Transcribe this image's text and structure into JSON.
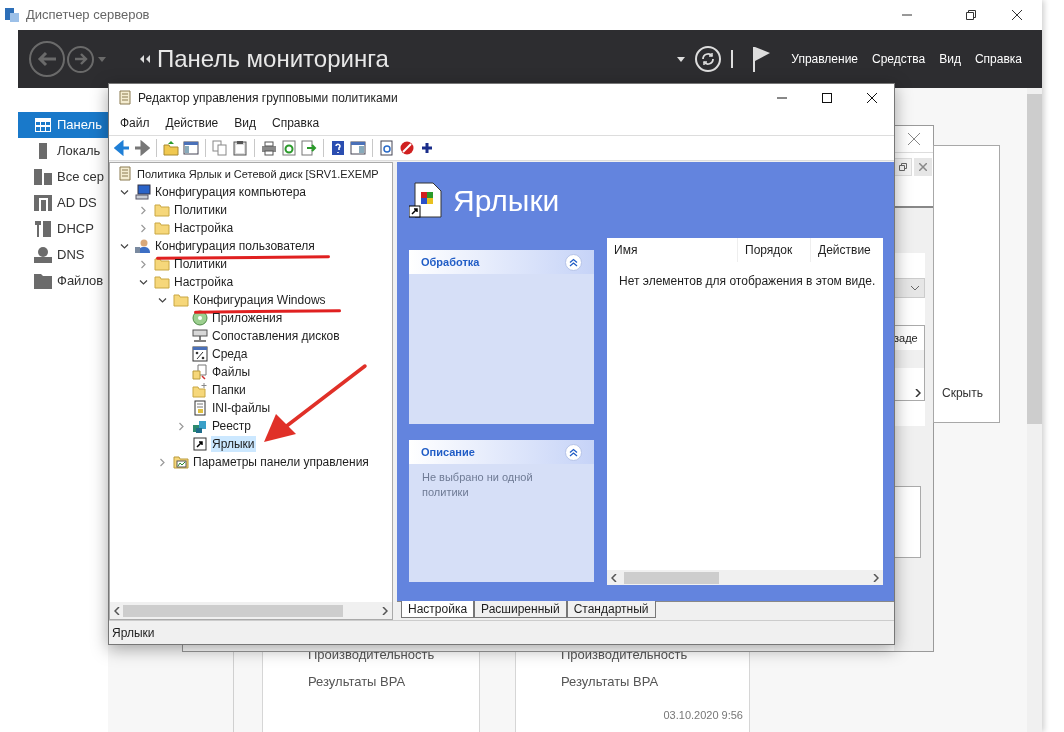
{
  "server_manager": {
    "title": "Диспетчер серверов",
    "header_title": "Панель мониторинга",
    "menu": [
      "Управление",
      "Средства",
      "Вид",
      "Справка"
    ],
    "sidebar": [
      {
        "kind": "dashboard",
        "label": "Панель",
        "selected": true
      },
      {
        "kind": "server",
        "label": "Локаль",
        "selected": false
      },
      {
        "kind": "servers",
        "label": "Все сер",
        "selected": false
      },
      {
        "kind": "adds",
        "label": "AD DS",
        "selected": false
      },
      {
        "kind": "dhcp",
        "label": "DHCP",
        "selected": false
      },
      {
        "kind": "dns",
        "label": "DNS",
        "selected": false
      },
      {
        "kind": "files",
        "label": "Файлов",
        "selected": false
      }
    ],
    "tiles": [
      {
        "items": [
          "Производительность",
          "Результаты BPA"
        ]
      },
      {
        "items": [
          "Производительность",
          "Результаты BPA"
        ],
        "timestamp": "03.10.2020 9:56"
      }
    ]
  },
  "background_dialog": {
    "column_text": "заде",
    "hide_button": "Скрыть"
  },
  "gpo_editor": {
    "title": "Редактор управления групповыми политиками",
    "menu": [
      "Файл",
      "Действие",
      "Вид",
      "Справка"
    ],
    "tree": {
      "kind": "root",
      "label": "Политика Ярлык и Сетевой диск [SRV1.EXEMP",
      "selected": false,
      "children": [
        {
          "kind": "computer",
          "label": "Конфигурация компьютера",
          "expanded": true,
          "selected": false,
          "children": [
            {
              "kind": "folder",
              "label": "Политики",
              "expanded": false,
              "selected": false
            },
            {
              "kind": "folder",
              "label": "Настройка",
              "expanded": false,
              "selected": false
            }
          ]
        },
        {
          "kind": "user",
          "label": "Конфигурация пользователя",
          "expanded": true,
          "annotated": true,
          "selected": false,
          "children": [
            {
              "kind": "folder",
              "label": "Политики",
              "expanded": false,
              "selected": false
            },
            {
              "kind": "folder",
              "label": "Настройка",
              "expanded": true,
              "selected": false,
              "children": [
                {
                  "kind": "folder",
                  "label": "Конфигурация Windows",
                  "expanded": true,
                  "annotated": true,
                  "selected": false,
                  "children": [
                    {
                      "kind": "apps",
                      "label": "Приложения",
                      "selected": false
                    },
                    {
                      "kind": "drives",
                      "label": "Сопоставления дисков",
                      "selected": false
                    },
                    {
                      "kind": "env",
                      "label": "Среда",
                      "selected": false
                    },
                    {
                      "kind": "files",
                      "label": "Файлы",
                      "selected": false
                    },
                    {
                      "kind": "folders",
                      "label": "Папки",
                      "selected": false
                    },
                    {
                      "kind": "ini",
                      "label": "INI-файлы",
                      "selected": false
                    },
                    {
                      "kind": "registry",
                      "label": "Реестр",
                      "expanded": false,
                      "selected": false
                    },
                    {
                      "kind": "shortcut",
                      "label": "Ярлыки",
                      "selected": true
                    }
                  ]
                },
                {
                  "kind": "control-panel",
                  "label": "Параметры панели управления",
                  "expanded": false,
                  "selected": false
                }
              ]
            }
          ]
        }
      ]
    },
    "heading": "Ярлыки",
    "panels": [
      {
        "title": "Обработка",
        "expanded": true
      },
      {
        "title": "Описание",
        "expanded": true,
        "text": "Не выбрано ни одной политики"
      }
    ],
    "table": {
      "columns": [
        "Имя",
        "Порядок",
        "Действие"
      ],
      "empty_message": "Нет элементов для отображения в этом виде."
    },
    "tabs": [
      {
        "label": "Настройка",
        "selected": true
      },
      {
        "label": "Расширенный",
        "selected": false
      },
      {
        "label": "Стандартный",
        "selected": false
      }
    ],
    "status_bar": "Ярлыки"
  }
}
